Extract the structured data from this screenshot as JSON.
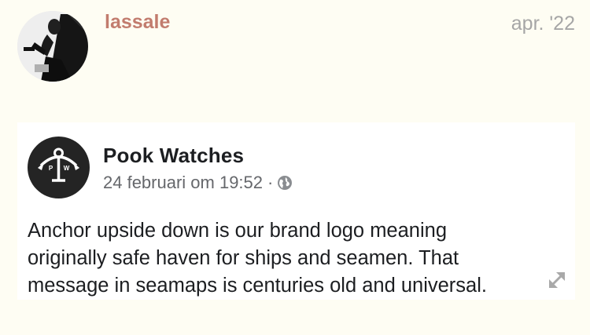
{
  "post": {
    "username": "lassale",
    "date": "apr. '22",
    "avatar_icon": "user-avatar-photo"
  },
  "embed": {
    "page_name": "Pook Watches",
    "timestamp": "24 februari om 19:52",
    "separator": "·",
    "privacy_icon": "globe-icon",
    "logo_icon": "anchor-logo",
    "logo_letters": [
      "P",
      "W"
    ],
    "text_lines": [
      "Anchor upside down is our brand logo meaning",
      "originally safe haven for ships and seamen. That",
      "message in seamaps is centuries old and universal."
    ]
  },
  "controls": {
    "expand_icon": "expand-icon"
  },
  "colors": {
    "background": "#fefdf3",
    "username": "#c27c6e",
    "date": "#a6a6a6",
    "card_background": "#ffffff",
    "logo_background": "#242424"
  }
}
